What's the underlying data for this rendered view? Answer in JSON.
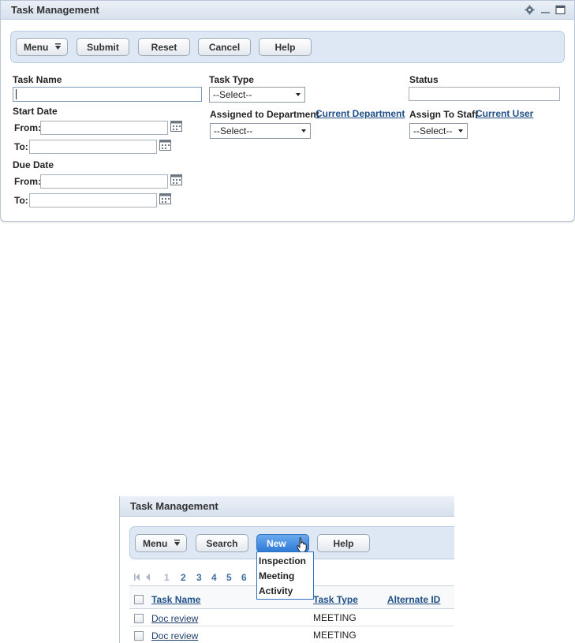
{
  "top_panel": {
    "title": "Task Management",
    "toolbar": {
      "menu_label": "Menu",
      "submit_label": "Submit",
      "reset_label": "Reset",
      "cancel_label": "Cancel",
      "help_label": "Help"
    },
    "form": {
      "task_name_label": "Task Name",
      "task_name_value": "",
      "start_date_label": "Start Date",
      "start_from_label": "From:",
      "start_to_label": "To:",
      "due_date_label": "Due Date",
      "due_from_label": "From:",
      "due_to_label": "To:",
      "task_type_label": "Task Type",
      "task_type_value": "--Select--",
      "assigned_dept_label": "Assigned to Department",
      "current_dept_link": "Current Department",
      "dept_value": "--Select--",
      "status_label": "Status",
      "status_value": "",
      "assign_staff_label": "Assign To Staff",
      "current_user_link": "Current User",
      "staff_value": "--Select--"
    }
  },
  "bottom_panel": {
    "title": "Task Management",
    "toolbar": {
      "menu_label": "Menu",
      "search_label": "Search",
      "new_label": "New",
      "help_label": "Help"
    },
    "new_menu": [
      "Inspection",
      "Meeting",
      "Activity"
    ],
    "pager": [
      "1",
      "2",
      "3",
      "4",
      "5",
      "6"
    ],
    "columns": [
      "Task Name",
      "Task Type",
      "Alternate ID"
    ],
    "rows": [
      {
        "task_name": "Doc review",
        "task_type": "MEETING",
        "alternate_id": ""
      },
      {
        "task_name": "Doc review",
        "task_type": "MEETING",
        "alternate_id": ""
      }
    ]
  },
  "colors": {
    "title_bar": "#d7e1ed",
    "toolbar_bg": "#dde8f4",
    "link": "#1f4f86",
    "new_button": "#2f7ad6"
  }
}
